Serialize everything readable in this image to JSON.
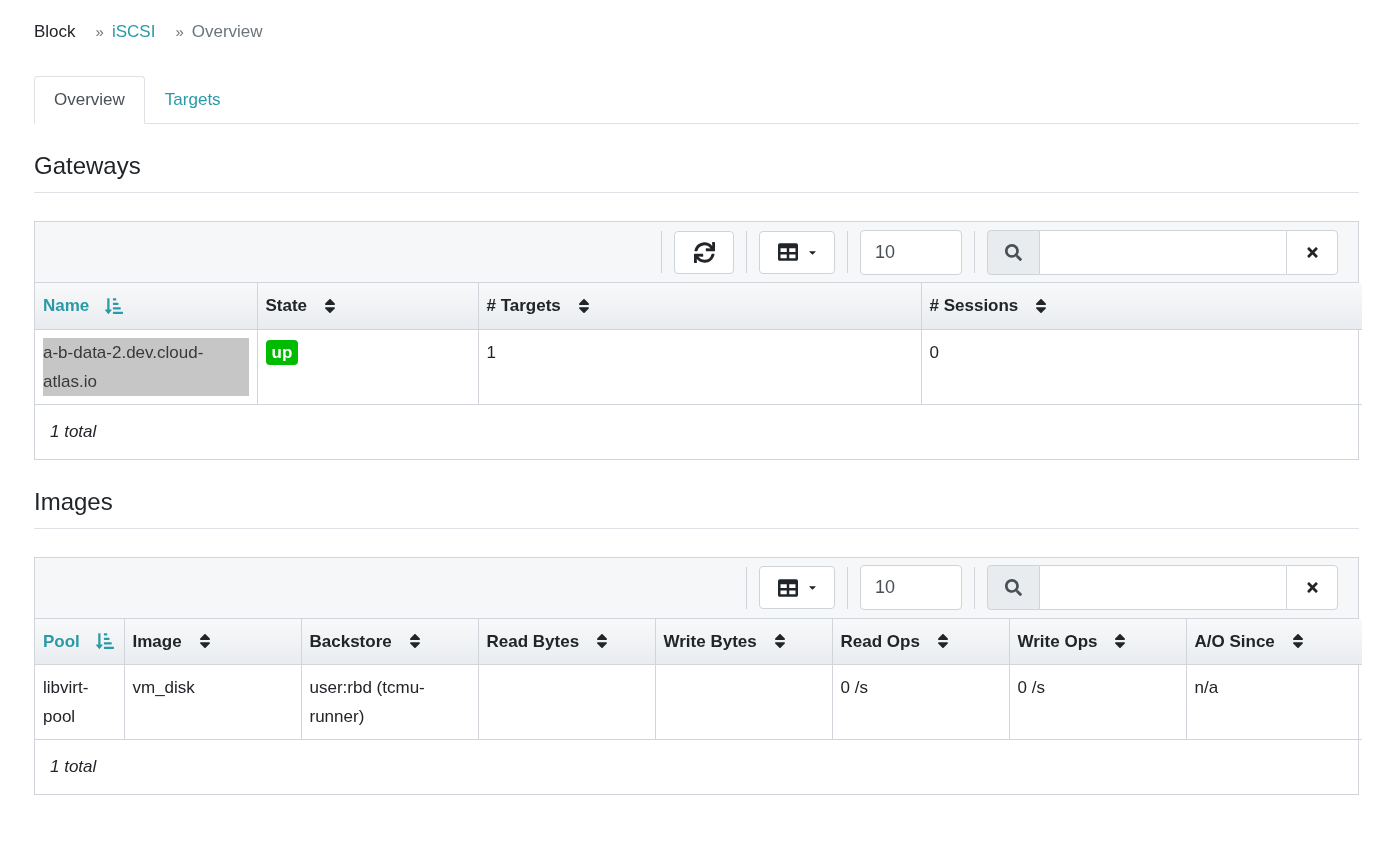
{
  "breadcrumb": [
    {
      "label": "Block",
      "kind": "plain"
    },
    {
      "separator": "»",
      "label": "iSCSI",
      "kind": "link"
    },
    {
      "separator": "»",
      "label": "Overview",
      "kind": "current"
    }
  ],
  "tabs": [
    {
      "label": "Overview",
      "selected": true
    },
    {
      "label": "Targets",
      "selected": false
    }
  ],
  "sections": [
    {
      "title": "Gateways",
      "toolbar": {
        "refresh_button": true,
        "page_size": "10"
      },
      "columns": [
        {
          "label": "Name",
          "sorted": true
        },
        {
          "label": "State",
          "sorted": false
        },
        {
          "label": "# Targets",
          "sorted": false
        },
        {
          "label": "# Sessions",
          "sorted": false
        }
      ],
      "rows": [
        {
          "first_cell_highlighted": true,
          "cells": [
            {
              "kind": "text",
              "text": "a-b-data-2.dev.cloud-atlas.io"
            },
            {
              "kind": "badge",
              "text": "up",
              "color": "#00bb00"
            },
            {
              "kind": "text",
              "text": "1"
            },
            {
              "kind": "text",
              "text": "0"
            }
          ]
        }
      ],
      "footer": "1 total"
    },
    {
      "title": "Images",
      "toolbar": {
        "refresh_button": false,
        "page_size": "10"
      },
      "columns": [
        {
          "label": "Pool",
          "sorted": true
        },
        {
          "label": "Image",
          "sorted": false
        },
        {
          "label": "Backstore",
          "sorted": false
        },
        {
          "label": "Read Bytes",
          "sorted": false
        },
        {
          "label": "Write Bytes",
          "sorted": false
        },
        {
          "label": "Read Ops",
          "sorted": false
        },
        {
          "label": "Write Ops",
          "sorted": false
        },
        {
          "label": "A/O Since",
          "sorted": false
        }
      ],
      "rows": [
        {
          "first_cell_highlighted": false,
          "cells": [
            {
              "kind": "text",
              "text": "libvirt-pool"
            },
            {
              "kind": "text",
              "text": "vm_disk"
            },
            {
              "kind": "text",
              "text": "user:rbd (tcmu-runner)"
            },
            {
              "kind": "empty"
            },
            {
              "kind": "empty"
            },
            {
              "kind": "text",
              "text": "0 /s"
            },
            {
              "kind": "text",
              "text": "0 /s"
            },
            {
              "kind": "text",
              "text": "n/a"
            }
          ]
        }
      ],
      "footer": "1 total"
    }
  ]
}
